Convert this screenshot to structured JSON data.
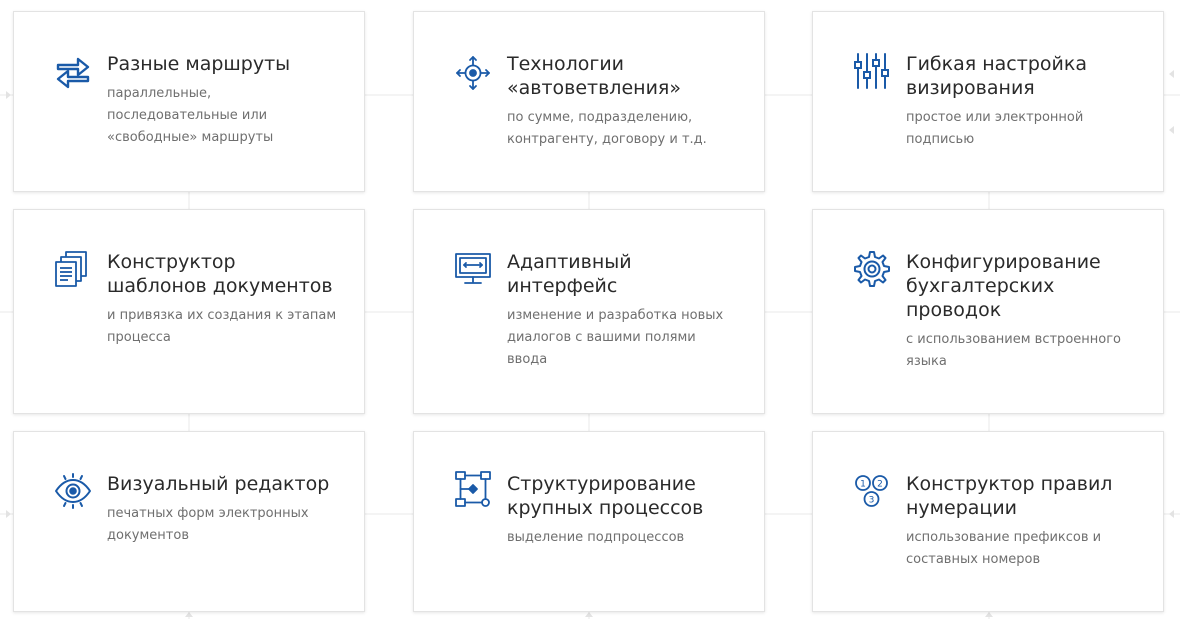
{
  "features": [
    {
      "icon": "route-arrows-icon",
      "title": "Разные маршруты",
      "desc": "параллельные,\nпоследовательные или\n«свободные» маршруты"
    },
    {
      "icon": "auto-branch-icon",
      "title": "Технологии\n«автоветвления»",
      "desc": "по сумме, подразделению,\nконтрагенту, договору и т.д."
    },
    {
      "icon": "sliders-icon",
      "title": "Гибкая настройка\nвизирования",
      "desc": "простое или электронной\nподписью"
    },
    {
      "icon": "document-templates-icon",
      "title": "Конструктор\nшаблонов документов",
      "desc": "и привязка их создания к этапам\nпроцесса"
    },
    {
      "icon": "monitor-icon",
      "title": "Адаптивный\nинтерфейс",
      "desc": "изменение и разработка новых\nдиалогов с вашими полями\nввода"
    },
    {
      "icon": "gear-icon",
      "title": "Конфигурирование\nбухгалтерских\nпроводок",
      "desc": "с использованием встроенного\nязыка"
    },
    {
      "icon": "eye-icon",
      "title": "Визуальный редактор",
      "desc": "печатных форм электронных\nдокументов"
    },
    {
      "icon": "process-structure-icon",
      "title": "Структурирование\nкрупных процессов",
      "desc": "выделение подпроцессов"
    },
    {
      "icon": "numbering-icon",
      "title": "Конструктор правил\nнумерации",
      "desc": "использование префиксов и\nсоставных номеров"
    }
  ],
  "colors": {
    "accent": "#1a5aa8",
    "title": "#2a2a2a",
    "desc": "#6f6f6f",
    "border": "#e3e3e3"
  }
}
